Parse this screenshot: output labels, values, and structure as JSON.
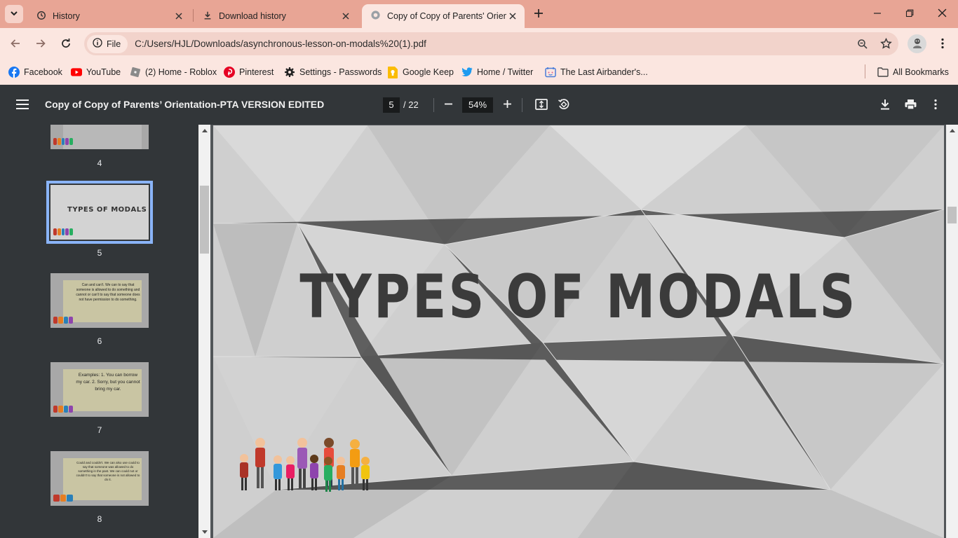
{
  "tabs": [
    {
      "title": "History",
      "icon": "history-icon"
    },
    {
      "title": "Download history",
      "icon": "download-icon"
    },
    {
      "title": "Copy of Copy of Parents' Orientation-PTA VERSION EDITED",
      "icon": "globe-icon",
      "active": true
    }
  ],
  "toolbar": {
    "chip_label": "File",
    "url": "C:/Users/HJL/Downloads/asynchronous-lesson-on-modals%20(1).pdf"
  },
  "bookmarks": [
    {
      "label": "Facebook",
      "icon": "facebook-icon",
      "color": "#1877f2"
    },
    {
      "label": "YouTube",
      "icon": "youtube-icon",
      "color": "#ff0000"
    },
    {
      "label": "(2) Home - Roblox",
      "icon": "roblox-icon",
      "color": "#7a7a7a"
    },
    {
      "label": "Pinterest",
      "icon": "pinterest-icon",
      "color": "#e60023"
    },
    {
      "label": "Settings - Passwords",
      "icon": "gear-icon",
      "color": "#222222"
    },
    {
      "label": "Google Keep",
      "icon": "google-keep-icon",
      "color": "#fbbc04"
    },
    {
      "label": "Home / Twitter",
      "icon": "twitter-icon",
      "color": "#1d9bf0"
    },
    {
      "label": "The Last Airbander's...",
      "icon": "calendar-icon",
      "color": "#4a7cd8"
    }
  ],
  "all_bookmarks_label": "All Bookmarks",
  "pdf": {
    "title": "Copy of Copy of Parents’ Orientation-PTA VERSION EDITED",
    "current_page": "5",
    "total_pages": "/ 22",
    "zoom": "54%",
    "slide_title": "TYPES OF MODALS"
  },
  "thumbnails": [
    {
      "number": "4",
      "text": ""
    },
    {
      "number": "5",
      "text": "TYPES OF MODALS",
      "selected": true
    },
    {
      "number": "6",
      "text": "Can and can't. We can to say that someone is allowed to do something and cannot or can't to say that someone does not have permission to do something."
    },
    {
      "number": "7",
      "text": "Examples: 1. You can borrow my car. 2. Sorry, but you cannot bring my car."
    },
    {
      "number": "8",
      "text": "Could and couldn't. We can also use could to say that someone was allowed to do something in the past. We can could not or couldn't to say that someone is not allowed to do it."
    }
  ],
  "colors": {
    "tab_strip": "#e8a595",
    "toolbar": "#fbe6e0",
    "pdf_toolbar": "#323639",
    "selected_thumb": "#8ab4f8"
  }
}
